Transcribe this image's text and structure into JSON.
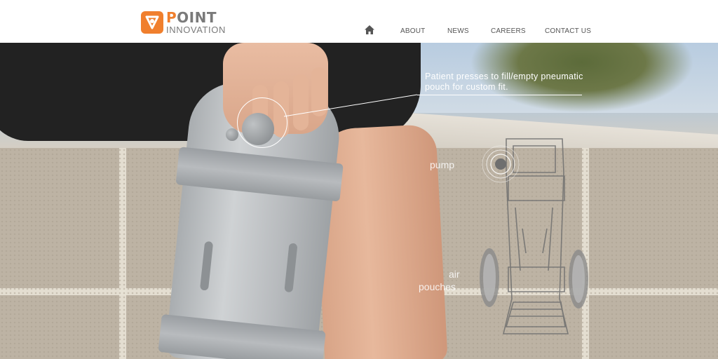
{
  "header": {
    "logo": {
      "brand_top_accent": "P",
      "brand_top": "OINT",
      "brand_bottom": "INNOVATION",
      "icon": "point-innovation-logo-icon",
      "accent_color": "#f07f2d"
    },
    "nav": {
      "home_icon": "home-icon",
      "items": [
        {
          "label": "ABOUT"
        },
        {
          "label": "NEWS"
        },
        {
          "label": "CAREERS"
        },
        {
          "label": "CONTACT US"
        }
      ]
    }
  },
  "hero": {
    "caption": "Patient presses to fill/empty pneumatic pouch for custom fit.",
    "label_pump": "pump",
    "label_air_line1": "air",
    "label_air_line2": "pouches"
  }
}
